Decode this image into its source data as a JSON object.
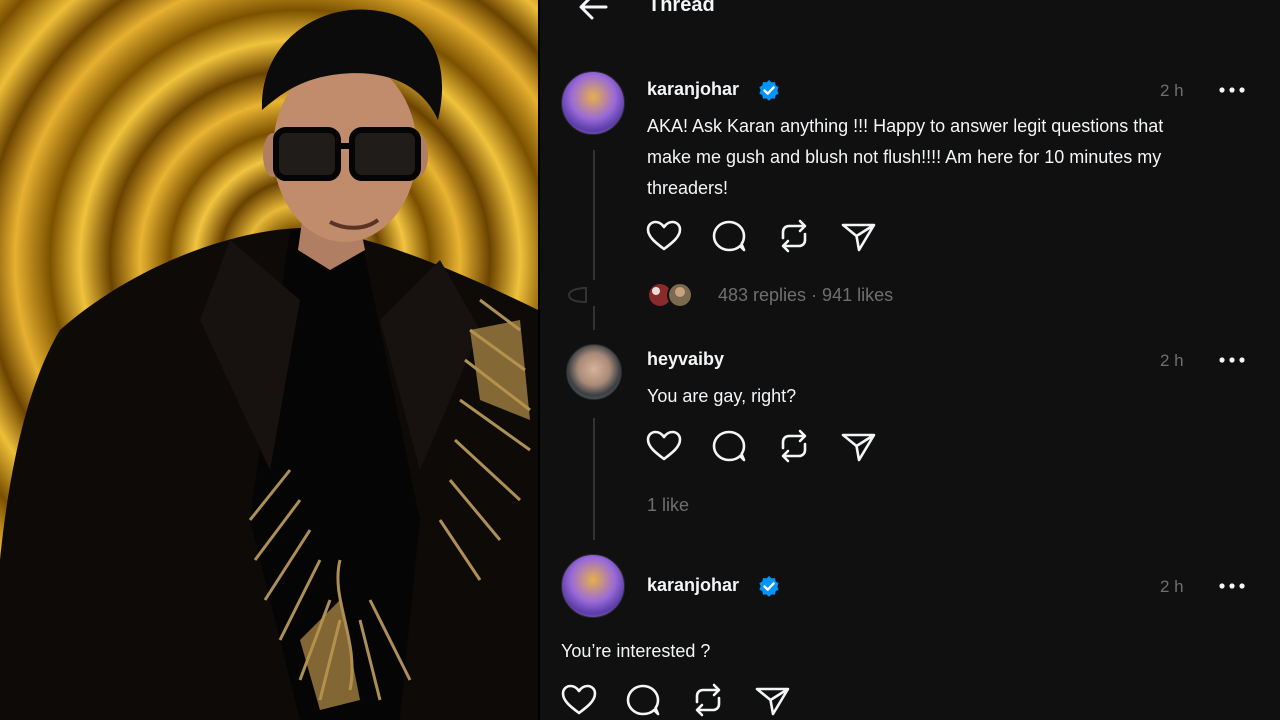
{
  "header": {
    "title": "Thread",
    "back_icon": "arrow-left-icon"
  },
  "posts": [
    {
      "username": "karanjohar",
      "verified": true,
      "time": "2 h",
      "text_lines": [
        "AKA! Ask Karan anything !!! Happy to answer legit questions that",
        "make me gush and blush not flush!!!! Am here for 10 minutes my",
        "threaders!"
      ],
      "actions": [
        "heart-icon",
        "comment-icon",
        "repost-icon",
        "share-icon"
      ],
      "meta": "483 replies · 941 likes"
    },
    {
      "username": "heyvaiby",
      "verified": false,
      "time": "2 h",
      "text_lines": [
        "You are gay, right?"
      ],
      "actions": [
        "heart-icon",
        "comment-icon",
        "repost-icon",
        "share-icon"
      ],
      "meta": "1 like"
    },
    {
      "username": "karanjohar",
      "verified": true,
      "time": "2 h",
      "text_lines": [
        "You’re interested ?"
      ],
      "actions": [
        "heart-icon",
        "comment-icon",
        "repost-icon",
        "share-icon"
      ]
    }
  ],
  "colors": {
    "background": "#101010",
    "text": "#f3f5f7",
    "muted": "#6f6f6f",
    "verified_blue": "#0095f6",
    "photo_gold": "#e8b838"
  }
}
